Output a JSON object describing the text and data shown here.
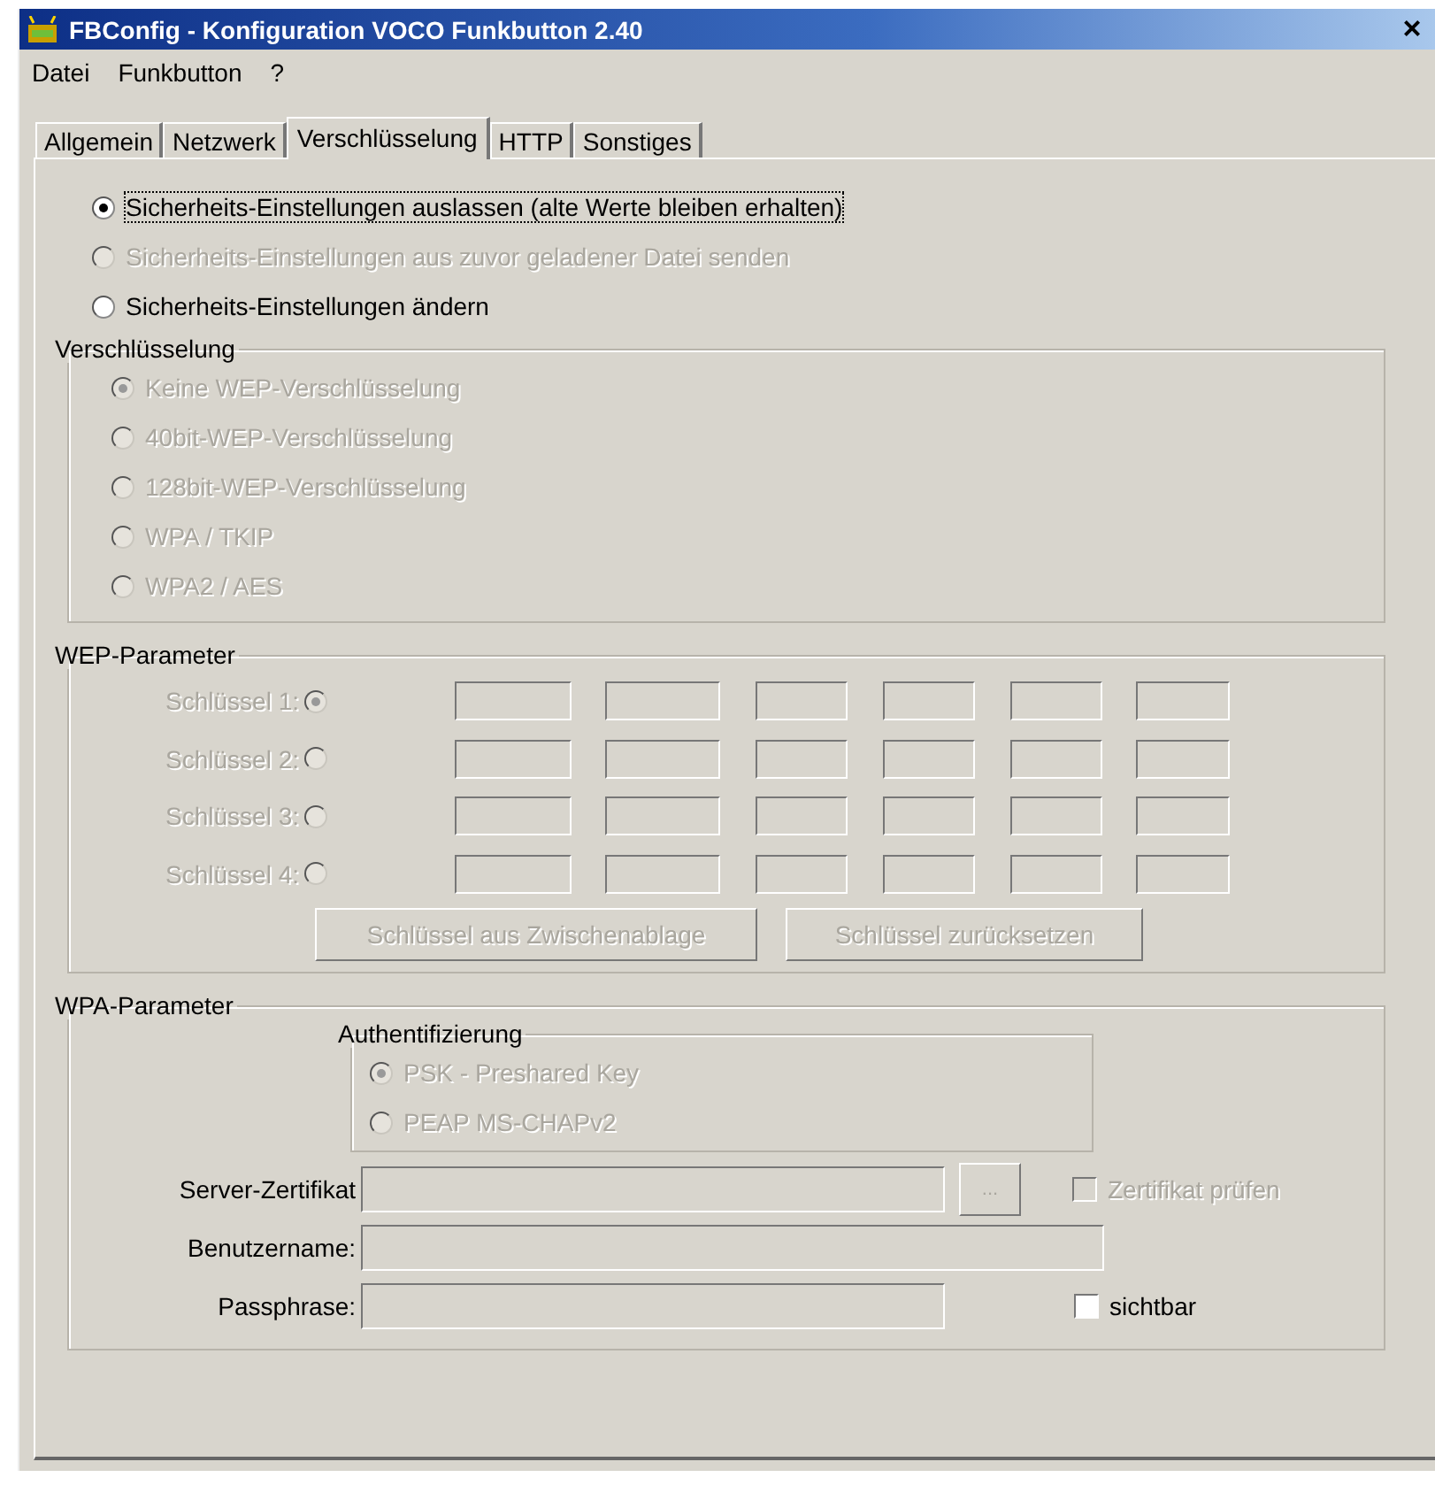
{
  "window": {
    "title": "FBConfig - Konfiguration VOCO Funkbutton 2.40",
    "close": "×"
  },
  "menu": [
    "Datei",
    "Funkbutton",
    "?"
  ],
  "tabs": [
    {
      "label": "Allgemein",
      "selected": false
    },
    {
      "label": "Netzwerk",
      "selected": false
    },
    {
      "label": "Verschlüsselung",
      "selected": true
    },
    {
      "label": "HTTP",
      "selected": false
    },
    {
      "label": "Sonstiges",
      "selected": false
    }
  ],
  "security_options": [
    {
      "label": "Sicherheits-Einstellungen auslassen (alte Werte bleiben erhalten)",
      "selected": true,
      "disabled": false
    },
    {
      "label": "Sicherheits-Einstellungen aus zuvor geladener Datei senden",
      "selected": false,
      "disabled": true
    },
    {
      "label": "Sicherheits-Einstellungen ändern",
      "selected": false,
      "disabled": false
    }
  ],
  "encryption": {
    "title": "Verschlüsselung",
    "options": [
      {
        "label": "Keine WEP-Verschlüsselung",
        "selected": true,
        "disabled": true
      },
      {
        "label": "40bit-WEP-Verschlüsselung",
        "selected": false,
        "disabled": true
      },
      {
        "label": "128bit-WEP-Verschlüsselung",
        "selected": false,
        "disabled": true
      },
      {
        "label": "WPA / TKIP",
        "selected": false,
        "disabled": true
      },
      {
        "label": "WPA2 / AES",
        "selected": false,
        "disabled": true
      }
    ]
  },
  "wep": {
    "title": "WEP-Parameter",
    "keys": [
      {
        "label": "Schlüssel 1:",
        "selected": true,
        "disabled": true
      },
      {
        "label": "Schlüssel 2:",
        "selected": false,
        "disabled": true
      },
      {
        "label": "Schlüssel 3:",
        "selected": false,
        "disabled": true
      },
      {
        "label": "Schlüssel 4:",
        "selected": false,
        "disabled": true
      }
    ],
    "buttons": [
      {
        "label": "Schlüssel aus Zwischenablage",
        "disabled": true
      },
      {
        "label": "Schlüssel zurücksetzen",
        "disabled": true
      }
    ]
  },
  "wpa": {
    "title": "WPA-Parameter",
    "auth": {
      "title": "Authentifizierung",
      "options": [
        {
          "label": "PSK - Preshared Key",
          "selected": true,
          "disabled": true
        },
        {
          "label": "PEAP MS-CHAPv2",
          "selected": false,
          "disabled": true
        }
      ]
    },
    "server_certificate": {
      "label": "Server-Zertifikat",
      "browse": "...",
      "check": {
        "label": "Zertifikat prüfen",
        "checked": false,
        "disabled": true
      }
    },
    "username": {
      "label": "Benutzername:"
    },
    "passphrase": {
      "label": "Passphrase:",
      "show": {
        "label": "sichtbar",
        "checked": false,
        "disabled": false
      }
    }
  }
}
